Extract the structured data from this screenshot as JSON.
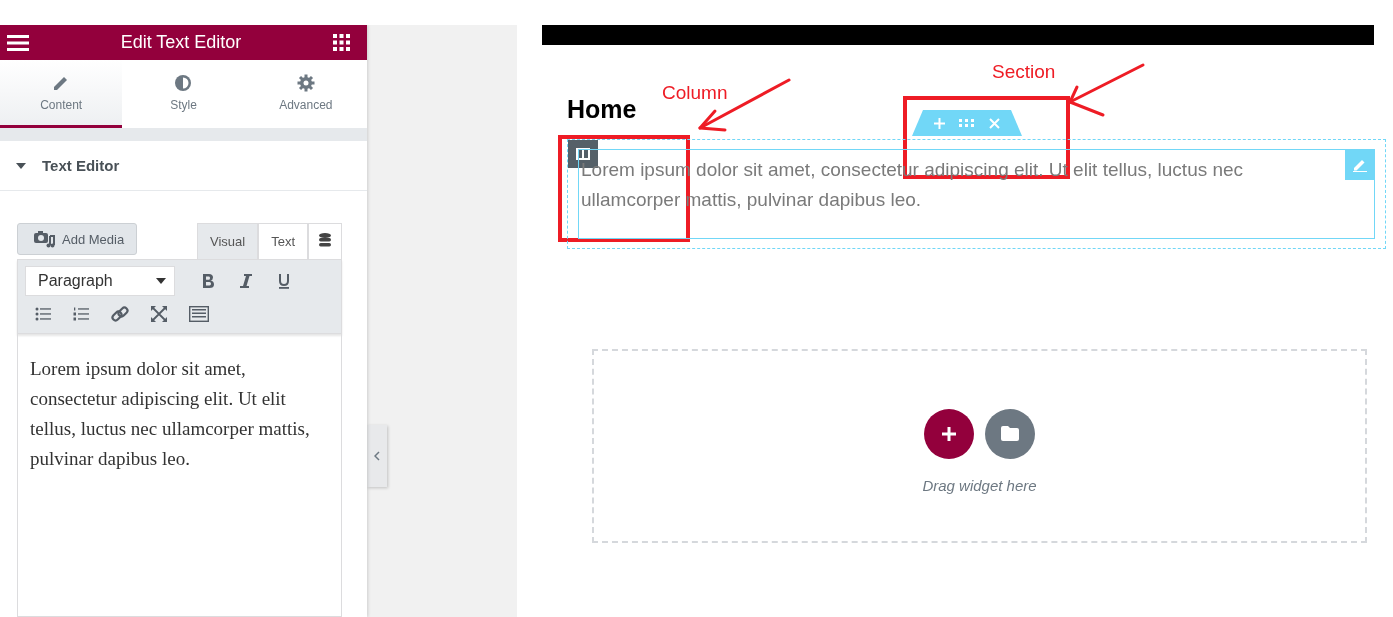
{
  "panel": {
    "title": "Edit Text Editor",
    "tabs": [
      {
        "label": "Content",
        "selected": true
      },
      {
        "label": "Style",
        "selected": false
      },
      {
        "label": "Advanced",
        "selected": false
      }
    ],
    "section": {
      "title": "Text Editor",
      "expanded": true
    },
    "add_media": "Add Media",
    "mode_tabs": [
      {
        "label": "Visual",
        "selected": true
      },
      {
        "label": "Text",
        "selected": false
      }
    ],
    "format_select": "Paragraph",
    "editor_text": "Lorem ipsum dolor sit amet, consectetur adipiscing elit. Ut elit tellus, luctus nec ullamcorper mattis, pulvinar dapibus leo."
  },
  "page": {
    "heading": "Home",
    "text": "Lorem ipsum dolor sit amet, consectetur adipiscing elit. Ut elit tellus, luctus nec ullamcorper mattis, pulvinar dapibus leo.",
    "drop_zone": "Drag widget here"
  },
  "annotations": [
    {
      "label": "Column"
    },
    {
      "label": "Section"
    }
  ]
}
